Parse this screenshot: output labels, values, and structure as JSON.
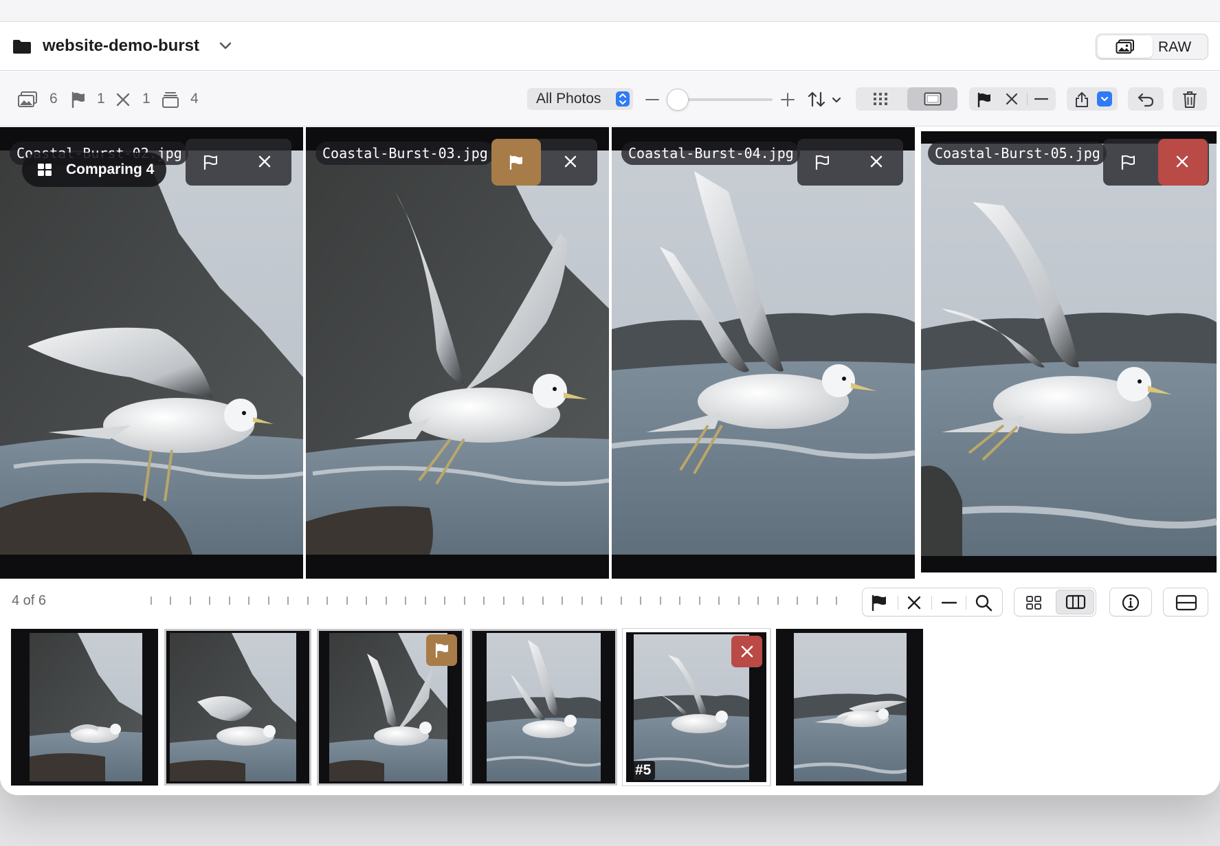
{
  "titlebar": {
    "folder_name": "website-demo-burst",
    "raw_label": "RAW"
  },
  "toolbar": {
    "photo_count": "6",
    "flag_count": "1",
    "reject_count": "1",
    "stack_count": "4",
    "filter_label": "All Photos"
  },
  "compare": {
    "badge": "Comparing 4",
    "panels": [
      {
        "filename": "Coastal-Burst-02.jpg",
        "flagged": false,
        "rejected": false
      },
      {
        "filename": "Coastal-Burst-03.jpg",
        "flagged": true,
        "rejected": false
      },
      {
        "filename": "Coastal-Burst-04.jpg",
        "flagged": false,
        "rejected": false
      },
      {
        "filename": "Coastal-Burst-05.jpg",
        "flagged": false,
        "rejected": true
      }
    ]
  },
  "bottombar": {
    "pager": "4 of 6"
  },
  "filmstrip": {
    "thumbs": [
      {
        "id": "1",
        "flagged": false,
        "rejected": false
      },
      {
        "id": "2",
        "flagged": false,
        "rejected": false
      },
      {
        "id": "3",
        "flagged": true,
        "rejected": false
      },
      {
        "id": "4",
        "flagged": false,
        "rejected": false
      },
      {
        "id": "5",
        "flagged": false,
        "rejected": true,
        "badge": "#5"
      },
      {
        "id": "6",
        "flagged": false,
        "rejected": false
      }
    ]
  },
  "colors": {
    "accent_blue": "#2f7bf5",
    "flag_brown": "#a87c48",
    "reject_red": "#b94a45"
  },
  "icons": [
    "folder-icon",
    "chevron-down-icon",
    "photos-icon",
    "flag-icon",
    "x-icon",
    "stack-icon",
    "minus-icon",
    "plus-icon",
    "sort-icon",
    "grid-icon",
    "single-view-icon",
    "share-icon",
    "undo-icon",
    "trash-icon",
    "search-icon",
    "info-icon",
    "filmstrip-toggle-icon",
    "compare-grid-icon"
  ]
}
